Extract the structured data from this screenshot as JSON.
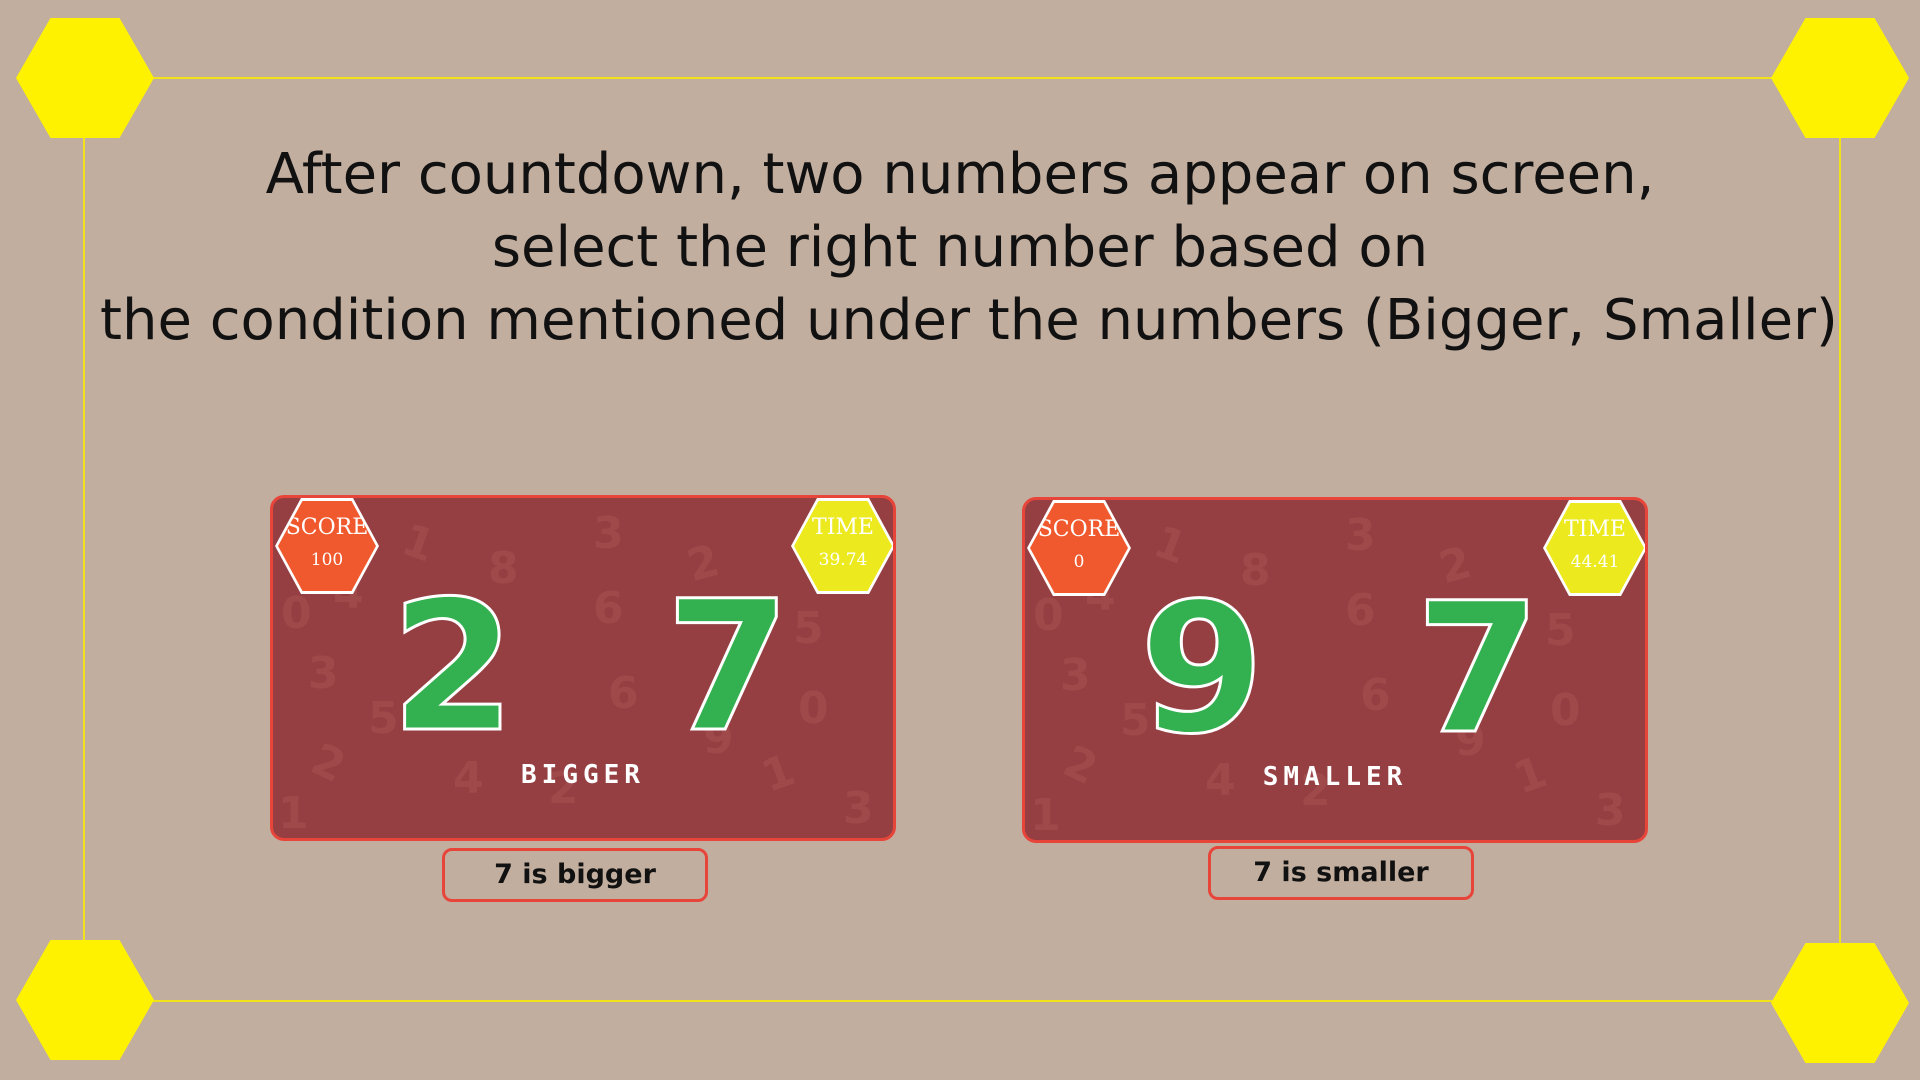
{
  "instructions": {
    "line1": "After countdown, two numbers appear on screen,",
    "line2": "select the right number based on",
    "line3": "the condition mentioned under the numbers (Bigger, Smaller)"
  },
  "colors": {
    "background": "#c2ae9f",
    "frame_yellow": "#fff200",
    "card_bg": "#953f43",
    "card_border": "#e8453a",
    "number_green": "#33b04f",
    "score_badge": "#f0592d",
    "time_badge": "#ecea1f"
  },
  "examples": [
    {
      "score_label": "SCORE",
      "score_value": "100",
      "time_label": "TIME",
      "time_value": "39.74",
      "left_number": "2",
      "right_number": "7",
      "condition": "BIGGER",
      "caption": "7 is bigger"
    },
    {
      "score_label": "SCORE",
      "score_value": "0",
      "time_label": "TIME",
      "time_value": "44.41",
      "left_number": "9",
      "right_number": "7",
      "condition": "SMALLER",
      "caption": "7 is smaller"
    }
  ]
}
